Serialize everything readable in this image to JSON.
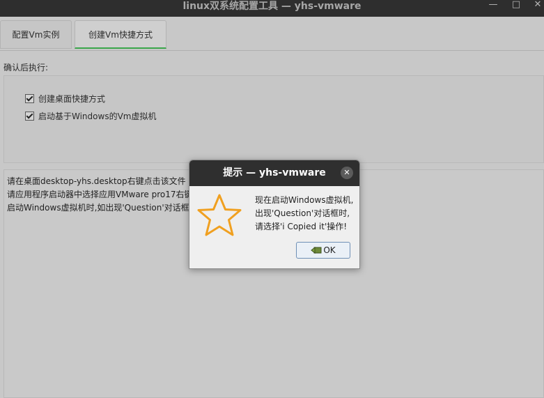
{
  "window": {
    "title": "linux双系统配置工具 — yhs-vmware",
    "minimize_icon": "minimize-icon",
    "maximize_icon": "maximize-icon",
    "close_icon": "close-icon"
  },
  "tabs": [
    {
      "label": "配置Vm实例",
      "active": false
    },
    {
      "label": "创建Vm快捷方式",
      "active": true
    }
  ],
  "section": {
    "label": "确认后执行:",
    "checkboxes": [
      {
        "label": "创建桌面快捷方式",
        "checked": true
      },
      {
        "label": "启动基于Windows的Vm虚拟机",
        "checked": true
      }
    ]
  },
  "log": {
    "lines": [
      "请在桌面desktop-yhs.desktop右键点击该文件 ->",
      "请应用程序启动器中选择应用VMware pro17右键",
      "启动Windows虚拟机时,如出现'Question'对话框"
    ]
  },
  "dialog": {
    "title": "提示 — yhs-vmware",
    "icon": "star-icon",
    "message_lines": [
      "现在启动Windows虚拟机,",
      "出现'Question'对话框时,",
      "请选择'i Copied it'操作!"
    ],
    "ok_label": "OK",
    "accent_color": "#f0a020"
  },
  "colors": {
    "active_tab_indicator": "#3aa64a",
    "titlebar": "#2e2e2e"
  }
}
